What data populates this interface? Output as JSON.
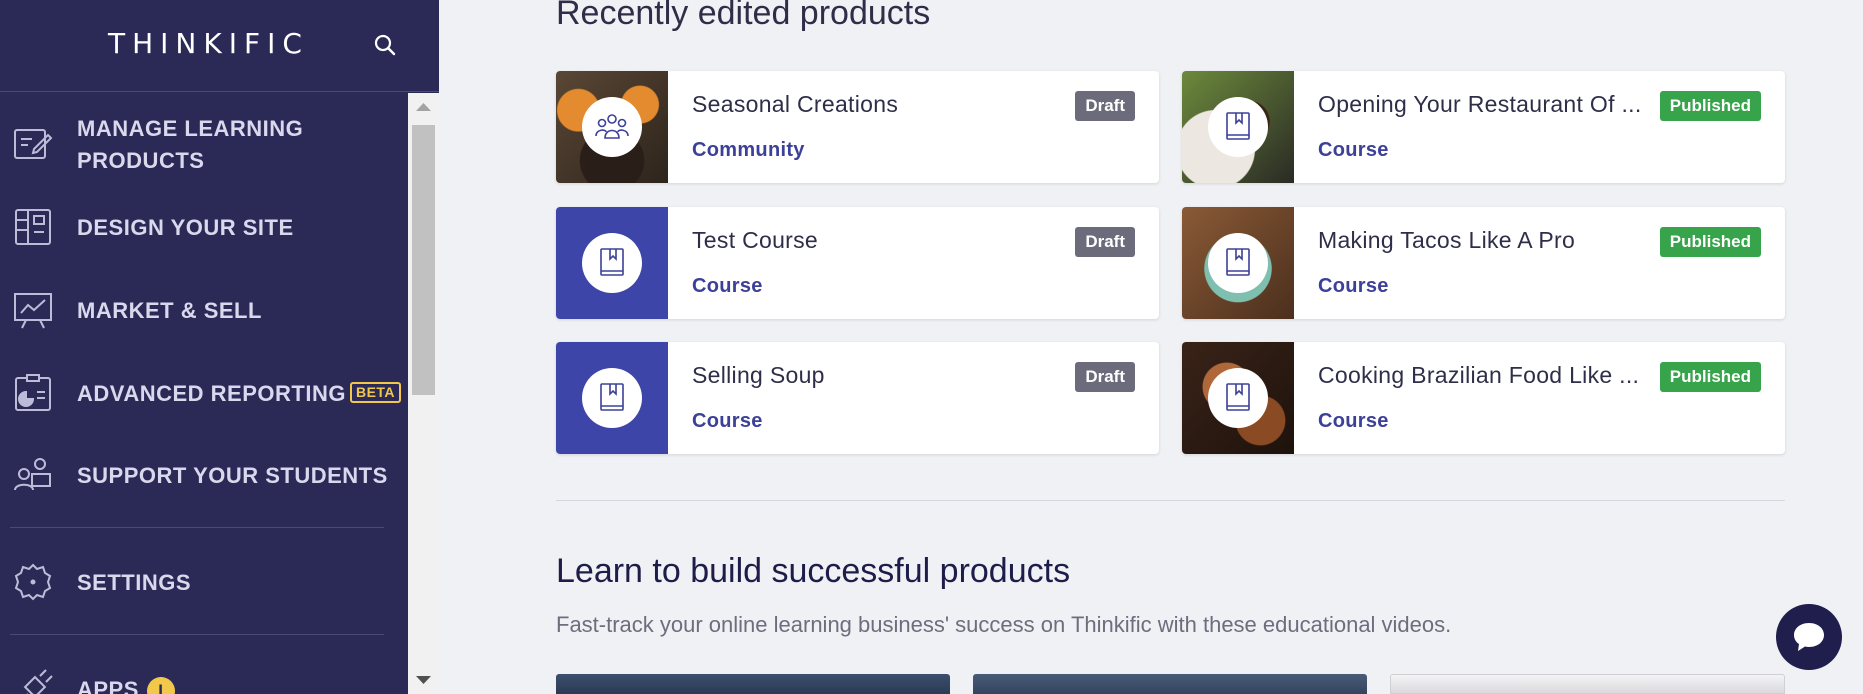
{
  "sidebar": {
    "logo": "THINKIFIC",
    "items": [
      {
        "label": "MANAGE LEARNING",
        "label2": "PRODUCTS"
      },
      {
        "label": "DESIGN YOUR SITE"
      },
      {
        "label": "MARKET & SELL"
      },
      {
        "label": "ADVANCED REPORTING",
        "badge": "BETA"
      },
      {
        "label": "SUPPORT YOUR STUDENTS"
      },
      {
        "label": "SETTINGS"
      },
      {
        "label": "APPS",
        "badge": "i"
      }
    ]
  },
  "recent": {
    "title": "Recently edited products",
    "products": [
      {
        "title": "Seasonal Creations",
        "type": "Community",
        "status": "Draft"
      },
      {
        "title": "Opening Your Restaurant Of ...",
        "type": "Course",
        "status": "Published"
      },
      {
        "title": "Test Course",
        "type": "Course",
        "status": "Draft"
      },
      {
        "title": "Making Tacos Like A Pro",
        "type": "Course",
        "status": "Published"
      },
      {
        "title": "Selling Soup",
        "type": "Course",
        "status": "Draft"
      },
      {
        "title": "Cooking Brazilian Food Like ...",
        "type": "Course",
        "status": "Published"
      }
    ]
  },
  "learn": {
    "title": "Learn to build successful products",
    "subtitle": "Fast-track your online learning business' success on Thinkific with these educational videos."
  },
  "colors": {
    "sidebar_bg": "#2b2a57",
    "accent": "#3d4098",
    "draft": "#6b6b7b",
    "published": "#37a34a",
    "beta": "#f2c84b"
  }
}
